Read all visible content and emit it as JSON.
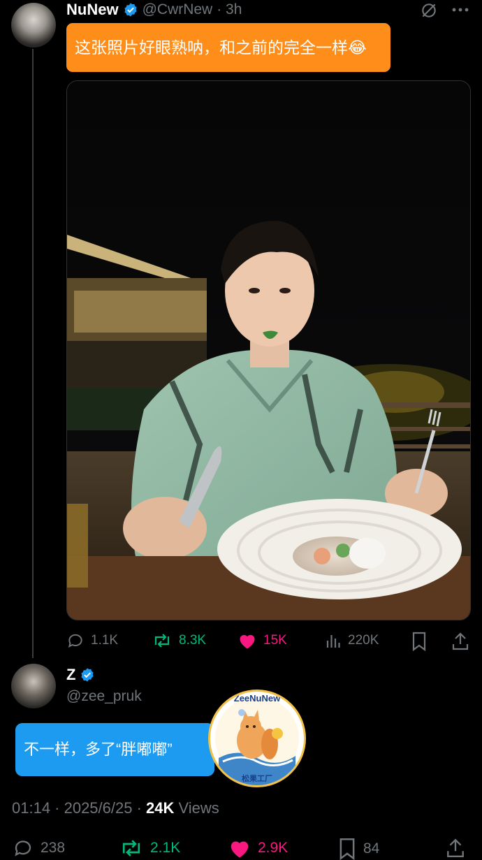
{
  "tweet": {
    "author_name": "NuNew",
    "author_handle": "@CwrNew",
    "time_ago": "· 3h",
    "translation": "这张照片好眼熟呐，和之前的完全一样😂",
    "stats": {
      "replies": "1.1K",
      "reposts": "8.3K",
      "likes": "15K",
      "views": "220K"
    }
  },
  "reply": {
    "author_name": "Z",
    "author_handle": "@zee_pruk",
    "translation": "不一样，多了“胖嘟嘟”",
    "timestamp": "01:14 · 2025/6/25 · ",
    "views_count": "24K",
    "views_label": " Views",
    "stats": {
      "replies": "238",
      "reposts": "2.1K",
      "likes": "2.9K",
      "bookmarks": "84"
    }
  },
  "sticker": {
    "top_text": "ZeeNuNew",
    "bottom_text": "松果工厂"
  },
  "colors": {
    "background": "#000000",
    "verified": "#1d9bf0",
    "repost": "#00ba7c",
    "like": "#f91880",
    "orange_bubble": "#ff8d1a",
    "blue_bubble": "#1d9bf0"
  },
  "icons": [
    "verified-icon",
    "grok-slash-icon",
    "more-icon",
    "reply-icon",
    "repost-icon",
    "like-icon",
    "views-icon",
    "bookmark-icon",
    "share-icon"
  ]
}
